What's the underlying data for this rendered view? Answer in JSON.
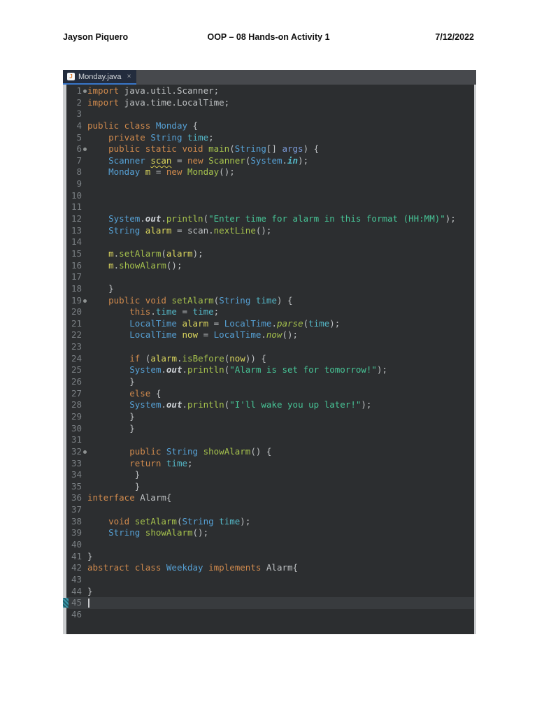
{
  "header": {
    "author": "Jayson Piquero",
    "title": "OOP – 08 Hands-on Activity 1",
    "date": "7/12/2022"
  },
  "editor": {
    "tab": {
      "label": "Monday.java",
      "close_glyph": "×",
      "icon": "java-file-icon",
      "icon_letter": "J"
    },
    "accent_colors": {
      "tab_underline": "#3876c9",
      "editor_bg": "#2c2e30",
      "tabbar_bg": "#47494d",
      "active_tab_bg": "#232c3d",
      "line_number": "#7b8084",
      "current_line_bg": "#383b3e"
    },
    "token_colors": {
      "k": "#d08a4d",
      "p": "#bec1c3",
      "t": "#56a0d4",
      "m": "#a6c24d",
      "ms": "#a6c24d",
      "s": "#47c496",
      "v": "#dcd75d",
      "vw": "#dcd75d",
      "f": "#55b9c9",
      "fi": "#55b9c9",
      "a": "#7b9bd8",
      "b": "#ced2d6"
    },
    "lines": [
      {
        "n": "1",
        "mark": "dot",
        "tokens": [
          [
            "k",
            "import"
          ],
          [
            "p",
            " java.util.Scanner;"
          ]
        ]
      },
      {
        "n": "2",
        "tokens": [
          [
            "k",
            "import"
          ],
          [
            "p",
            " java.time.LocalTime;"
          ]
        ]
      },
      {
        "n": "3",
        "tokens": []
      },
      {
        "n": "4",
        "tokens": [
          [
            "k",
            "public class"
          ],
          [
            "p",
            " "
          ],
          [
            "t",
            "Monday"
          ],
          [
            "p",
            " {"
          ]
        ]
      },
      {
        "n": "5",
        "tokens": [
          [
            "p",
            "    "
          ],
          [
            "k",
            "private"
          ],
          [
            "p",
            " "
          ],
          [
            "t",
            "String"
          ],
          [
            "p",
            " "
          ],
          [
            "f",
            "time"
          ],
          [
            "p",
            ";"
          ]
        ]
      },
      {
        "n": "6",
        "mark": "dot",
        "tokens": [
          [
            "p",
            "    "
          ],
          [
            "k",
            "public static void"
          ],
          [
            "p",
            " "
          ],
          [
            "m",
            "main"
          ],
          [
            "p",
            "("
          ],
          [
            "t",
            "String"
          ],
          [
            "p",
            "[] "
          ],
          [
            "a",
            "args"
          ],
          [
            "p",
            ") {"
          ]
        ]
      },
      {
        "n": "7",
        "mark": "bulb",
        "tokens": [
          [
            "p",
            "    "
          ],
          [
            "t",
            "Scanner"
          ],
          [
            "p",
            " "
          ],
          [
            "vw",
            "scan"
          ],
          [
            "p",
            " = "
          ],
          [
            "k",
            "new"
          ],
          [
            "p",
            " "
          ],
          [
            "m",
            "Scanner"
          ],
          [
            "p",
            "("
          ],
          [
            "t",
            "System"
          ],
          [
            "p",
            "."
          ],
          [
            "fi",
            "in"
          ],
          [
            "p",
            ");"
          ]
        ]
      },
      {
        "n": "8",
        "tokens": [
          [
            "p",
            "    "
          ],
          [
            "t",
            "Monday"
          ],
          [
            "p",
            " "
          ],
          [
            "v",
            "m"
          ],
          [
            "p",
            " = "
          ],
          [
            "k",
            "new"
          ],
          [
            "p",
            " "
          ],
          [
            "m",
            "Monday"
          ],
          [
            "p",
            "();"
          ]
        ]
      },
      {
        "n": "9",
        "tokens": []
      },
      {
        "n": "10",
        "tokens": []
      },
      {
        "n": "11",
        "tokens": []
      },
      {
        "n": "12",
        "tokens": [
          [
            "p",
            "    "
          ],
          [
            "t",
            "System"
          ],
          [
            "p",
            "."
          ],
          [
            "b",
            "out"
          ],
          [
            "p",
            "."
          ],
          [
            "m",
            "println"
          ],
          [
            "p",
            "("
          ],
          [
            "s",
            "\"Enter time for alarm in this format (HH:MM)\""
          ],
          [
            "p",
            ");"
          ]
        ]
      },
      {
        "n": "13",
        "tokens": [
          [
            "p",
            "    "
          ],
          [
            "t",
            "String"
          ],
          [
            "p",
            " "
          ],
          [
            "v",
            "alarm"
          ],
          [
            "p",
            " = scan."
          ],
          [
            "m",
            "nextLine"
          ],
          [
            "p",
            "();"
          ]
        ]
      },
      {
        "n": "14",
        "tokens": []
      },
      {
        "n": "15",
        "tokens": [
          [
            "p",
            "    "
          ],
          [
            "v",
            "m"
          ],
          [
            "p",
            "."
          ],
          [
            "m",
            "setAlarm"
          ],
          [
            "p",
            "("
          ],
          [
            "v",
            "alarm"
          ],
          [
            "p",
            ");"
          ]
        ]
      },
      {
        "n": "16",
        "tokens": [
          [
            "p",
            "    "
          ],
          [
            "v",
            "m"
          ],
          [
            "p",
            "."
          ],
          [
            "m",
            "showAlarm"
          ],
          [
            "p",
            "();"
          ]
        ]
      },
      {
        "n": "17",
        "tokens": []
      },
      {
        "n": "18",
        "tokens": [
          [
            "p",
            "    }"
          ]
        ]
      },
      {
        "n": "19",
        "mark": "dot",
        "tokens": [
          [
            "p",
            "    "
          ],
          [
            "k",
            "public void"
          ],
          [
            "p",
            " "
          ],
          [
            "m",
            "setAlarm"
          ],
          [
            "p",
            "("
          ],
          [
            "t",
            "String"
          ],
          [
            "p",
            " "
          ],
          [
            "f",
            "time"
          ],
          [
            "p",
            ") {"
          ]
        ]
      },
      {
        "n": "20",
        "tokens": [
          [
            "p",
            "        "
          ],
          [
            "k",
            "this"
          ],
          [
            "p",
            "."
          ],
          [
            "f",
            "time"
          ],
          [
            "p",
            " = "
          ],
          [
            "f",
            "time"
          ],
          [
            "p",
            ";"
          ]
        ]
      },
      {
        "n": "21",
        "tokens": [
          [
            "p",
            "        "
          ],
          [
            "t",
            "LocalTime"
          ],
          [
            "p",
            " "
          ],
          [
            "v",
            "alarm"
          ],
          [
            "p",
            " = "
          ],
          [
            "t",
            "LocalTime"
          ],
          [
            "p",
            "."
          ],
          [
            "ms",
            "parse"
          ],
          [
            "p",
            "("
          ],
          [
            "f",
            "time"
          ],
          [
            "p",
            ");"
          ]
        ]
      },
      {
        "n": "22",
        "tokens": [
          [
            "p",
            "        "
          ],
          [
            "t",
            "LocalTime"
          ],
          [
            "p",
            " "
          ],
          [
            "v",
            "now"
          ],
          [
            "p",
            " = "
          ],
          [
            "t",
            "LocalTime"
          ],
          [
            "p",
            "."
          ],
          [
            "ms",
            "now"
          ],
          [
            "p",
            "();"
          ]
        ]
      },
      {
        "n": "23",
        "tokens": []
      },
      {
        "n": "24",
        "tokens": [
          [
            "p",
            "        "
          ],
          [
            "k",
            "if"
          ],
          [
            "p",
            " ("
          ],
          [
            "v",
            "alarm"
          ],
          [
            "p",
            "."
          ],
          [
            "m",
            "isBefore"
          ],
          [
            "p",
            "("
          ],
          [
            "v",
            "now"
          ],
          [
            "p",
            ")) {"
          ]
        ]
      },
      {
        "n": "25",
        "tokens": [
          [
            "p",
            "        "
          ],
          [
            "t",
            "System"
          ],
          [
            "p",
            "."
          ],
          [
            "b",
            "out"
          ],
          [
            "p",
            "."
          ],
          [
            "m",
            "println"
          ],
          [
            "p",
            "("
          ],
          [
            "s",
            "\"Alarm is set for tomorrow!\""
          ],
          [
            "p",
            ");"
          ]
        ]
      },
      {
        "n": "26",
        "tokens": [
          [
            "p",
            "        }"
          ]
        ]
      },
      {
        "n": "27",
        "tokens": [
          [
            "p",
            "        "
          ],
          [
            "k",
            "else"
          ],
          [
            "p",
            " {"
          ]
        ]
      },
      {
        "n": "28",
        "tokens": [
          [
            "p",
            "        "
          ],
          [
            "t",
            "System"
          ],
          [
            "p",
            "."
          ],
          [
            "b",
            "out"
          ],
          [
            "p",
            "."
          ],
          [
            "m",
            "println"
          ],
          [
            "p",
            "("
          ],
          [
            "s",
            "\"I'll wake you up later!\""
          ],
          [
            "p",
            ");"
          ]
        ]
      },
      {
        "n": "29",
        "tokens": [
          [
            "p",
            "        }"
          ]
        ]
      },
      {
        "n": "30",
        "tokens": [
          [
            "p",
            "        }"
          ]
        ]
      },
      {
        "n": "31",
        "tokens": []
      },
      {
        "n": "32",
        "mark": "dot",
        "tokens": [
          [
            "p",
            "        "
          ],
          [
            "k",
            "public"
          ],
          [
            "p",
            " "
          ],
          [
            "t",
            "String"
          ],
          [
            "p",
            " "
          ],
          [
            "m",
            "showAlarm"
          ],
          [
            "p",
            "() {"
          ]
        ]
      },
      {
        "n": "33",
        "tokens": [
          [
            "p",
            "        "
          ],
          [
            "k",
            "return"
          ],
          [
            "p",
            " "
          ],
          [
            "f",
            "time"
          ],
          [
            "p",
            ";"
          ]
        ]
      },
      {
        "n": "34",
        "tokens": [
          [
            "p",
            "         }"
          ]
        ]
      },
      {
        "n": "35",
        "tokens": [
          [
            "p",
            "         }"
          ]
        ]
      },
      {
        "n": "36",
        "tokens": [
          [
            "k",
            "interface"
          ],
          [
            "p",
            " Alarm{"
          ]
        ]
      },
      {
        "n": "37",
        "tokens": []
      },
      {
        "n": "38",
        "tokens": [
          [
            "p",
            "    "
          ],
          [
            "k",
            "void"
          ],
          [
            "p",
            " "
          ],
          [
            "m",
            "setAlarm"
          ],
          [
            "p",
            "("
          ],
          [
            "t",
            "String"
          ],
          [
            "p",
            " "
          ],
          [
            "f",
            "time"
          ],
          [
            "p",
            ");"
          ]
        ]
      },
      {
        "n": "39",
        "tokens": [
          [
            "p",
            "    "
          ],
          [
            "t",
            "String"
          ],
          [
            "p",
            " "
          ],
          [
            "m",
            "showAlarm"
          ],
          [
            "p",
            "();"
          ]
        ]
      },
      {
        "n": "40",
        "tokens": []
      },
      {
        "n": "41",
        "tokens": [
          [
            "p",
            "}"
          ]
        ]
      },
      {
        "n": "42",
        "tokens": [
          [
            "k",
            "abstract class"
          ],
          [
            "p",
            " "
          ],
          [
            "t",
            "Weekday"
          ],
          [
            "p",
            " "
          ],
          [
            "k",
            "implements"
          ],
          [
            "p",
            " Alarm{"
          ]
        ]
      },
      {
        "n": "43",
        "tokens": []
      },
      {
        "n": "44",
        "tokens": [
          [
            "p",
            "}"
          ]
        ]
      },
      {
        "n": "45",
        "mark": "bookmark",
        "current": true,
        "caret": true,
        "tokens": []
      },
      {
        "n": "46",
        "tokens": []
      }
    ]
  }
}
